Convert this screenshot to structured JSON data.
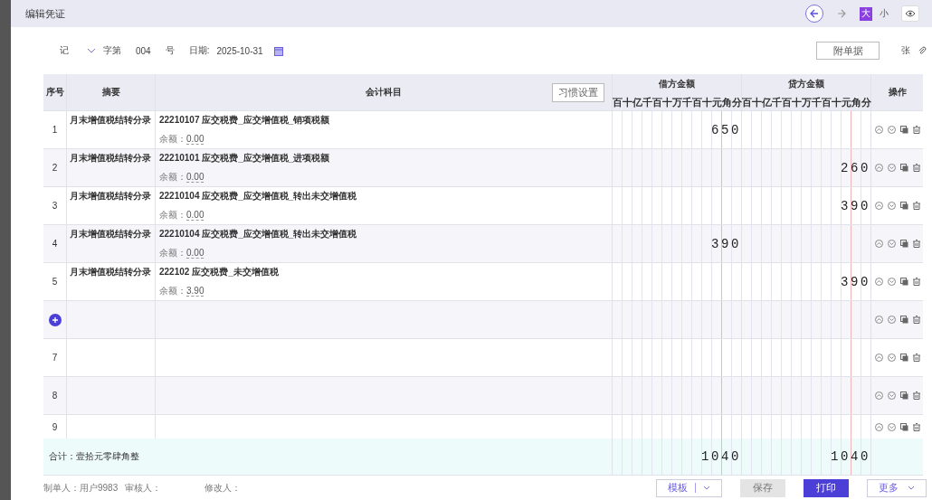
{
  "window": {
    "title": "编辑凭证"
  },
  "view_sizes": [
    {
      "label": "大",
      "selected": true
    },
    {
      "label": "小",
      "selected": false
    }
  ],
  "voucher": {
    "type": "记",
    "word_label": "字第",
    "number": "004",
    "number_suffix": "号",
    "date_label": "日期:",
    "date": "2025-10-31",
    "attachments_placeholder": "附单据",
    "attachments_unit": "张"
  },
  "table": {
    "columns": {
      "index": "序号",
      "summary": "摘要",
      "account": "会计科目",
      "settings_button": "习惯设置",
      "debit": "借方金额",
      "credit": "贷方金额",
      "actions": "操作"
    },
    "debit_units": [
      "百",
      "十",
      "亿",
      "千",
      "百",
      "十",
      "万",
      "千",
      "百",
      "十",
      "元",
      "角",
      "分"
    ],
    "credit_units": [
      "百",
      "十",
      "亿",
      "千",
      "百",
      "十",
      "万",
      "千",
      "百",
      "十",
      "元",
      "角",
      "分"
    ],
    "rows": [
      {
        "kind": "entry",
        "index": "1",
        "summary": "月末增值税结转分录",
        "account": "22210107 应交税费_应交增值税_销项税额",
        "balance_label": "余额：",
        "balance": "0.00",
        "debit": "650"
      },
      {
        "kind": "entry",
        "index": "2",
        "summary": "月末增值税结转分录",
        "account": "22210101 应交税费_应交增值税_进项税额",
        "balance_label": "余额：",
        "balance": "0.00",
        "credit": "260"
      },
      {
        "kind": "entry",
        "index": "3",
        "summary": "月末增值税结转分录",
        "account": "22210104 应交税费_应交增值税_转出未交增值税",
        "balance_label": "余额：",
        "balance": "0.00",
        "credit": "390"
      },
      {
        "kind": "entry",
        "index": "4",
        "summary": "月末增值税结转分录",
        "account": "22210104 应交税费_应交增值税_转出未交增值税",
        "balance_label": "余额：",
        "balance": "0.00",
        "debit": "390"
      },
      {
        "kind": "entry",
        "index": "5",
        "summary": "月末增值税结转分录",
        "account": "222102 应交税费_未交增值税",
        "balance_label": "余额：",
        "balance": "3.90",
        "credit": "390"
      },
      {
        "kind": "add"
      },
      {
        "kind": "empty",
        "index": "7"
      },
      {
        "kind": "empty",
        "index": "8"
      },
      {
        "kind": "empty",
        "index": "9"
      }
    ],
    "total": {
      "label": "合计：壹拾元零肆角整",
      "debit": "1040",
      "credit": "1040"
    }
  },
  "footer": {
    "people": [
      "制单人：用户9983",
      "审核人：",
      "修改人："
    ],
    "buttons": [
      {
        "label": "模板",
        "kind": "split"
      },
      {
        "label": "保存",
        "kind": "disabled"
      },
      {
        "label": "打印",
        "kind": "primary"
      },
      {
        "label": "更多",
        "kind": "menu"
      }
    ]
  }
}
